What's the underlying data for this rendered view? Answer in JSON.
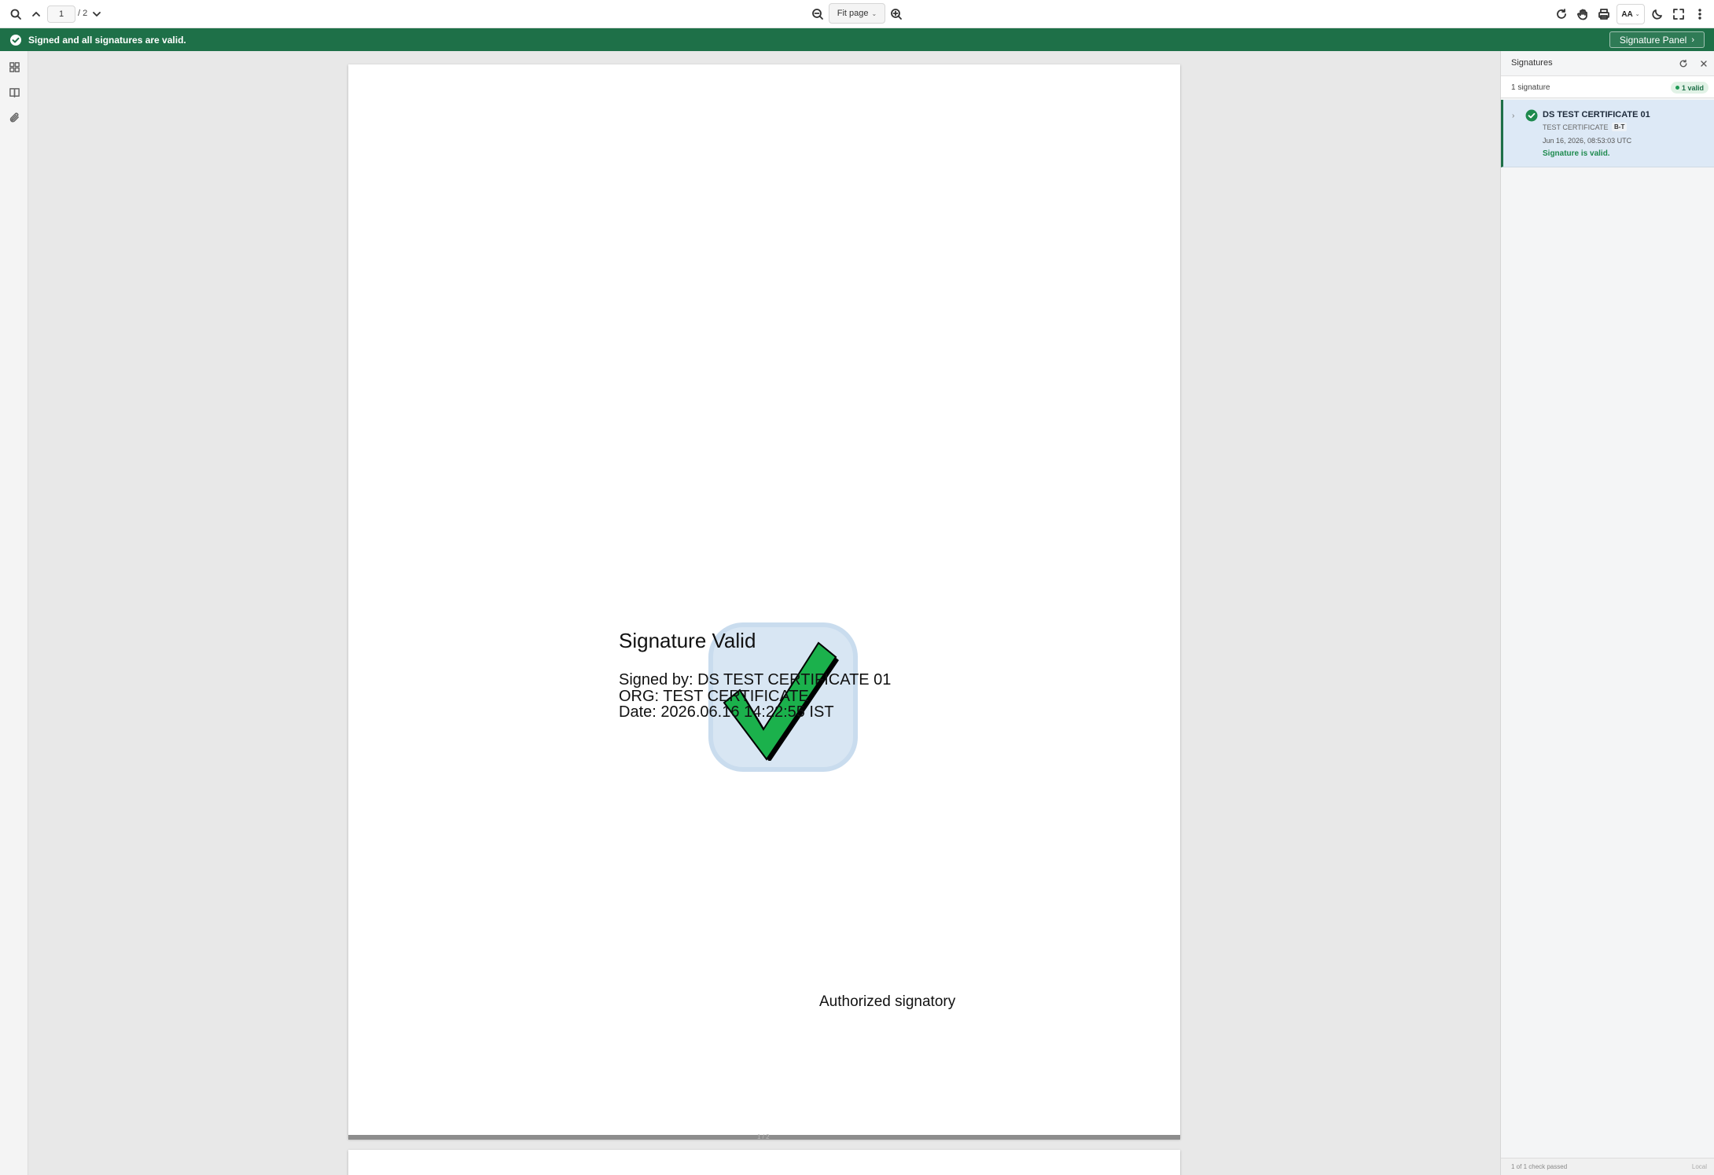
{
  "toolbar": {
    "page_current": "1",
    "page_total": "/ 2",
    "zoom_label": "Fit page",
    "font_toggle_label": "AA",
    "icons": [
      "search-icon",
      "chevron-up-icon",
      "chevron-down-icon",
      "zoom-out-icon",
      "zoom-in-icon",
      "refresh-icon",
      "hand-icon",
      "print-icon",
      "moon-icon",
      "fullscreen-icon",
      "more-icon"
    ]
  },
  "banner": {
    "text": "Signed and all signatures are valid.",
    "button_label": "Signature Panel",
    "color": "#1e7048"
  },
  "left_rail": {
    "icons": [
      "thumbnails-icon",
      "outline-icon",
      "attachment-icon"
    ]
  },
  "document": {
    "signature_title": "Signature Valid",
    "signed_by": "Signed by: DS TEST CERTIFICATE 01",
    "org": "ORG: TEST CERTIFICATE",
    "date": "Date: 2026.06.16 14:22:55 IST",
    "authorized": "Authorized signatory",
    "page_separator_label": "1 / 2",
    "check_color": "#1bb14c"
  },
  "signature_panel": {
    "title": "Signatures",
    "count_label": "1 signature",
    "valid_badge": "1 valid",
    "signatures": [
      {
        "name": "DS TEST CERTIFICATE 01",
        "org": "TEST CERTIFICATE",
        "level": "B-T",
        "date": "Jun 16, 2026, 08:53:03 UTC",
        "status": "Signature is valid."
      }
    ],
    "footer_left": "1 of 1 check passed",
    "footer_right": "Local"
  }
}
